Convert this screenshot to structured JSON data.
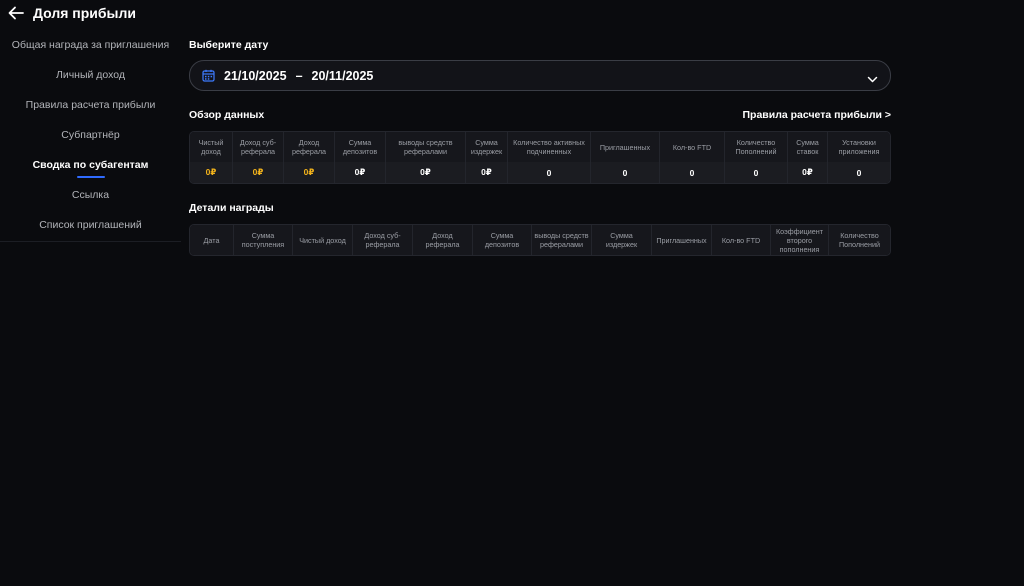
{
  "header": {
    "title": "Доля прибыли"
  },
  "sidebar": {
    "items": [
      {
        "label": "Общая награда за приглашения"
      },
      {
        "label": "Личный доход"
      },
      {
        "label": "Правила расчета прибыли"
      },
      {
        "label": "Субпартнёр"
      },
      {
        "label": "Сводка по субагентам"
      },
      {
        "label": "Ссылка"
      },
      {
        "label": "Список приглашений"
      }
    ],
    "active_index": 4
  },
  "date": {
    "label": "Выберите дату",
    "start": "21/10/2025",
    "separator": "–",
    "end": "20/11/2025"
  },
  "overview": {
    "title": "Обзор данных",
    "rules_link": "Правила расчета прибыли >",
    "columns": [
      "Чистый доход",
      "Доход суб-реферала",
      "Доход реферала",
      "Сумма депозитов",
      "выводы средств рефералами",
      "Сумма издержек",
      "Количество активных подчиненных",
      "Приглашенных",
      "Кол-во FTD",
      "Количество Пополнений",
      "Сумма ставок",
      "Установки приложения"
    ],
    "values": [
      "0₽",
      "0₽",
      "0₽",
      "0₽",
      "0₽",
      "0₽",
      "0",
      "0",
      "0",
      "0",
      "0₽",
      "0"
    ],
    "highlight_color": "#f3b31b"
  },
  "details": {
    "title": "Детали награды",
    "columns": [
      "Дата",
      "Сумма поступления",
      "Чистый доход",
      "Доход суб-реферала",
      "Доход реферала",
      "Сумма депозитов",
      "выводы средств рефералами",
      "Сумма издержек",
      "Приглашенных",
      "Кол-во FTD",
      "Коэффициент второго пополнения",
      "Количество Пополнений"
    ]
  },
  "colors": {
    "accent": "#2f6bff",
    "background": "#0a0b0e",
    "gold": "#f3b31b"
  }
}
